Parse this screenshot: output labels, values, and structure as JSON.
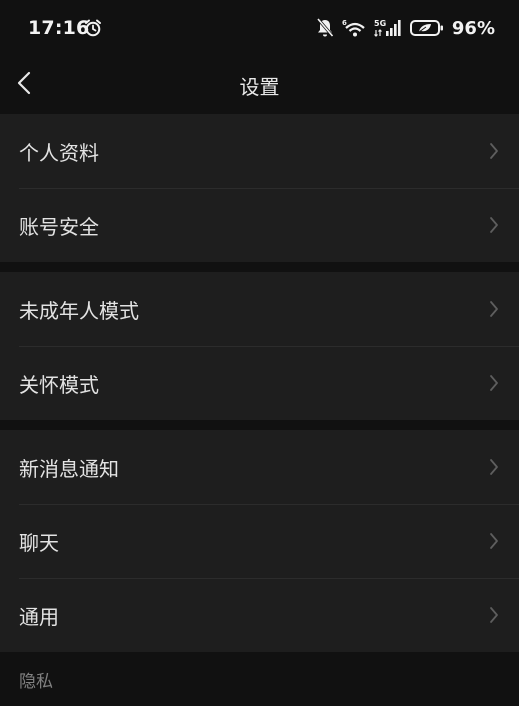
{
  "status_bar": {
    "time": "17:16",
    "battery": "96%",
    "icons": [
      "alarm-icon",
      "mute-bell-icon",
      "wifi-icon",
      "5g-signal-icon",
      "battery-icon"
    ]
  },
  "nav": {
    "title": "设置",
    "back_icon": "back-chevron-icon"
  },
  "groups": [
    {
      "items": [
        {
          "label": "个人资料"
        },
        {
          "label": "账号安全"
        }
      ]
    },
    {
      "items": [
        {
          "label": "未成年人模式"
        },
        {
          "label": "关怀模式"
        }
      ]
    },
    {
      "items": [
        {
          "label": "新消息通知"
        },
        {
          "label": "聊天"
        },
        {
          "label": "通用"
        }
      ]
    }
  ],
  "privacy_section": {
    "title": "隐私"
  },
  "colors": {
    "background": "#111111",
    "card": "#1e1e1e",
    "text": "#e3e3e3",
    "muted": "#808080",
    "chevron": "#5e5e5e"
  }
}
